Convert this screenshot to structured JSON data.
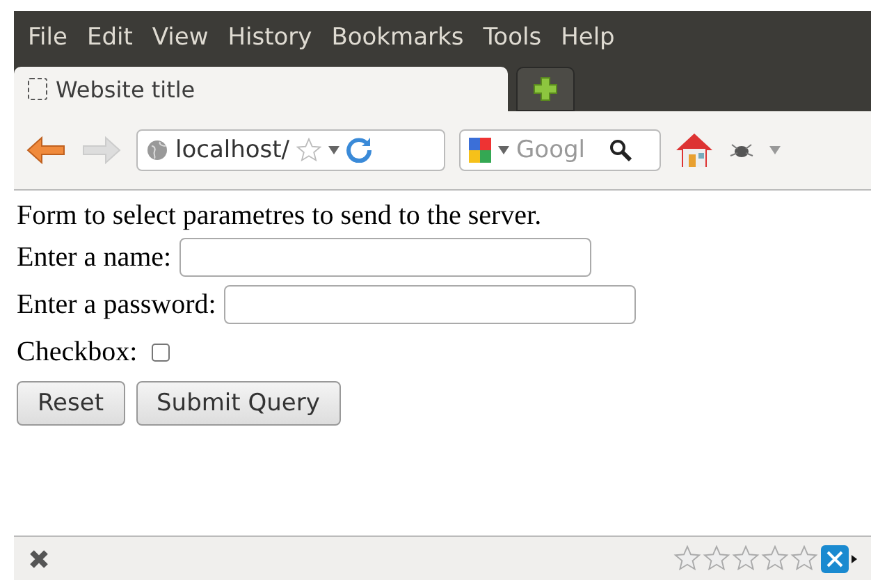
{
  "menu": [
    {
      "label": "File"
    },
    {
      "label": "Edit"
    },
    {
      "label": "View"
    },
    {
      "label": "History"
    },
    {
      "label": "Bookmarks"
    },
    {
      "label": "Tools"
    },
    {
      "label": "Help"
    }
  ],
  "tabs": [
    {
      "label": "Website title",
      "selected": true
    }
  ],
  "toolbar": {
    "address": "localhost/",
    "search_placeholder": "Googl"
  },
  "form": {
    "intro": "Form to select parametres to send to the server.",
    "fields": [
      {
        "kind": "text",
        "label": "Enter a name:"
      },
      {
        "kind": "password",
        "label": "Enter a password:"
      },
      {
        "kind": "checkbox",
        "label": "Checkbox:",
        "checked": false
      }
    ],
    "buttons": [
      "Reset",
      "Submit Query"
    ]
  },
  "status_bar": {
    "stars": 0
  }
}
